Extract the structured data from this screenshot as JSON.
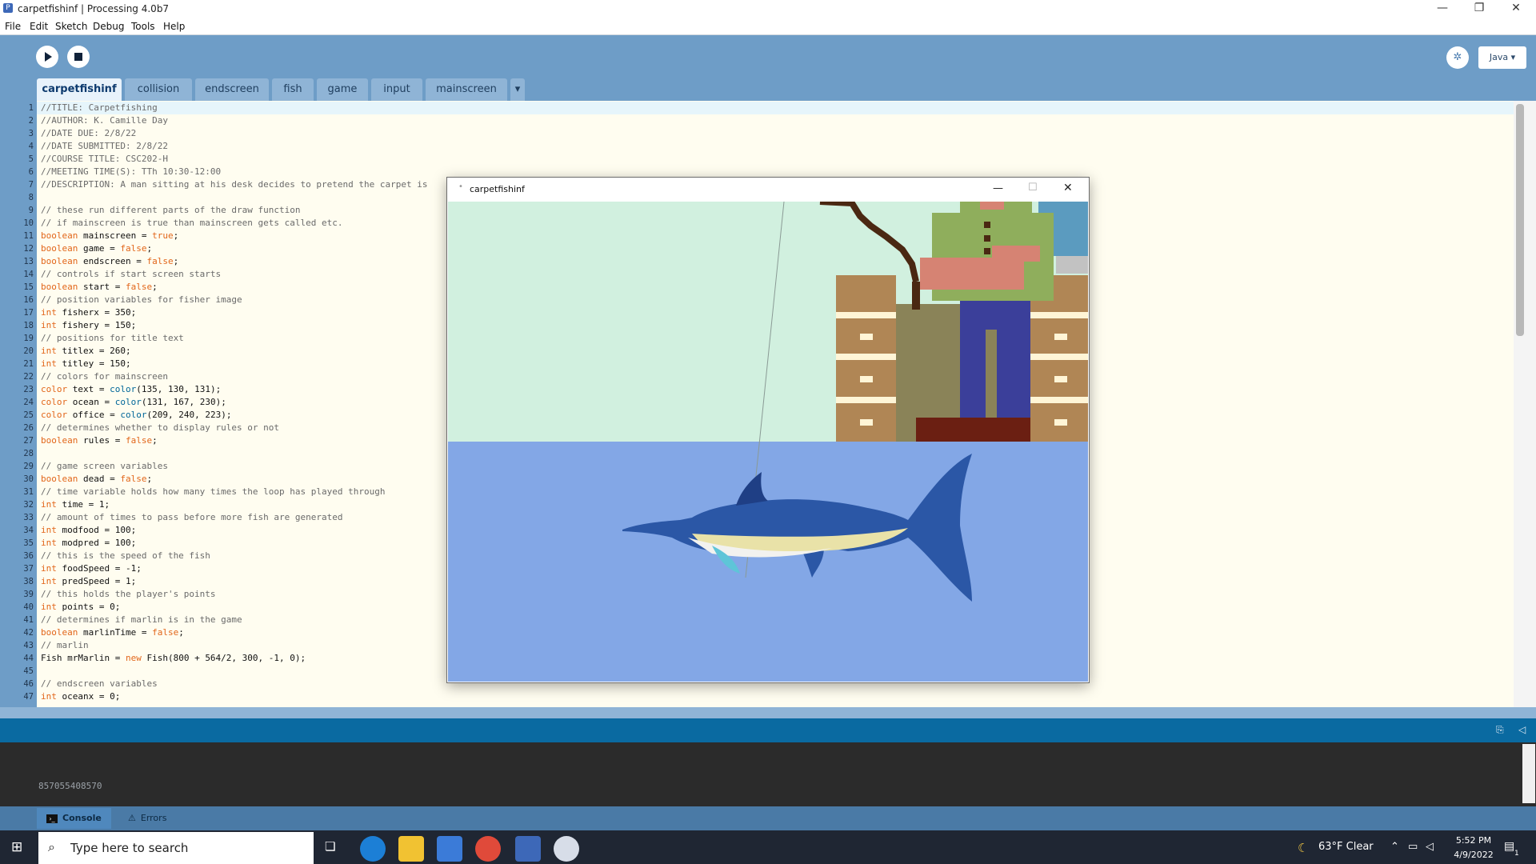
{
  "window": {
    "title": "carpetfishinf | Processing 4.0b7",
    "controls": [
      "—",
      "❐",
      "✕"
    ]
  },
  "menu": [
    "File",
    "Edit",
    "Sketch",
    "Debug",
    "Tools",
    "Help"
  ],
  "toolbar": {
    "mode": "Java ▾",
    "debug_icon": "debug-icon"
  },
  "tabs": {
    "items": [
      "carpetfishinf",
      "collision",
      "endscreen",
      "fish",
      "game",
      "input",
      "mainscreen"
    ],
    "more": "▾"
  },
  "editor": {
    "line_numbers": [
      "1",
      "2",
      "3",
      "4",
      "5",
      "6",
      "7",
      "8",
      "9",
      "10",
      "11",
      "12",
      "13",
      "14",
      "15",
      "16",
      "17",
      "18",
      "19",
      "20",
      "21",
      "22",
      "23",
      "24",
      "25",
      "26",
      "27",
      "28",
      "29",
      "30",
      "31",
      "32",
      "33",
      "34",
      "35",
      "36",
      "37",
      "38",
      "39",
      "40",
      "41",
      "42",
      "43",
      "44",
      "45",
      "46",
      "47"
    ],
    "lines": [
      "//TITLE: Carpetfishing",
      "//AUTHOR: K. Camille Day",
      "//DATE DUE: 2/8/22",
      "//DATE SUBMITTED: 2/8/22",
      "//COURSE TITLE: CSC202-H",
      "//MEETING TIME(S): TTh 10:30-12:00",
      "//DESCRIPTION: A man sitting at his desk decides to pretend the carpet is",
      "",
      "// these run different parts of the draw function",
      "// if mainscreen is true than mainscreen gets called etc.",
      "boolean mainscreen = true;",
      "boolean game = false;",
      "boolean endscreen = false;",
      "// controls if start screen starts",
      "boolean start = false;",
      "// position variables for fisher image",
      "int fisherx = 350;",
      "int fishery = 150;",
      "// positions for title text",
      "int titlex = 260;",
      "int titley = 150;",
      "// colors for mainscreen",
      "color text = color(135, 130, 131);",
      "color ocean = color(131, 167, 230);",
      "color office = color(209, 240, 223);",
      "// determines whether to display rules or not",
      "boolean rules = false;",
      "",
      "// game screen variables",
      "boolean dead = false;",
      "// time variable holds how many times the loop has played through",
      "int time = 1;",
      "// amount of times to pass before more fish are generated",
      "int modfood = 100;",
      "int modpred = 100;",
      "// this is the speed of the fish",
      "int foodSpeed = -1;",
      "int predSpeed = 1;",
      "// this holds the player's points",
      "int points = 0;",
      "// determines if marlin is in the game",
      "boolean marlinTime = false;",
      "// marlin",
      "Fish mrMarlin = new Fish(800 + 564/2, 300, -1, 0);",
      "",
      "// endscreen variables",
      "int oceanx = 0;"
    ]
  },
  "sketch_window": {
    "title": "carpetfishinf",
    "controls": [
      "—",
      "☐",
      "✕"
    ]
  },
  "console": {
    "output": "857055408570",
    "tabs": [
      "Console",
      "Errors"
    ]
  },
  "taskbar": {
    "search_placeholder": "Type here to search",
    "weather": "63°F  Clear",
    "time": "5:52 PM",
    "date": "4/9/2022",
    "notification_count": "1"
  },
  "colors": {
    "toolbar": "#6e9dc7",
    "office": "#d1f0df",
    "ocean": "#83a7e6",
    "keyword": "#e2661a"
  }
}
